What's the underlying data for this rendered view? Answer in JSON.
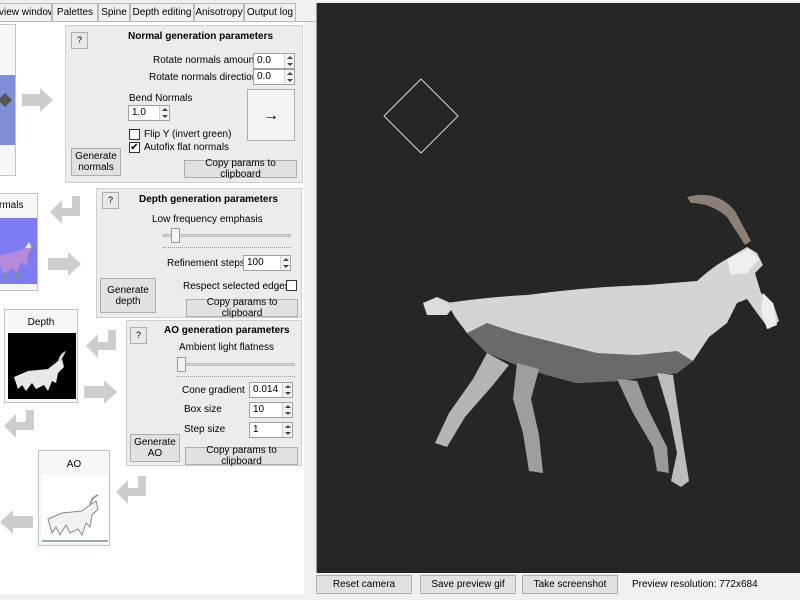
{
  "tabs": [
    {
      "label": "view window"
    },
    {
      "label": "Palettes"
    },
    {
      "label": "Spine"
    },
    {
      "label": "Depth editing"
    },
    {
      "label": "Anisotropy"
    },
    {
      "label": "Output log"
    }
  ],
  "normal_panel": {
    "help": "?",
    "title": "Normal generation parameters",
    "rotate_amount_label": "Rotate normals amount",
    "rotate_amount_value": "0.0",
    "rotate_direction_label": "Rotate normals direction",
    "rotate_direction_value": "0.0",
    "bend_label": "Bend Normals",
    "bend_value": "1.0",
    "flip_y_label": "Flip Y (invert green)",
    "flip_y_checked": false,
    "autofix_label": "Autofix flat normals",
    "autofix_checked": true,
    "direction_button": "→",
    "generate_label": "Generate normals",
    "copy_label": "Copy params to clipboard"
  },
  "depth_panel": {
    "help": "?",
    "title": "Depth generation parameters",
    "low_freq_label": "Low frequency emphasis",
    "low_freq_value": 0.0,
    "refinement_label": "Refinement steps:",
    "refinement_value": "100",
    "respect_edges_label": "Respect selected edges",
    "respect_edges_checked": false,
    "generate_label": "Generate depth",
    "copy_label": "Copy params to clipboard"
  },
  "ao_panel": {
    "help": "?",
    "title": "AO generation parameters",
    "flatness_label": "Ambient light flatness",
    "flatness_value": 0.0,
    "cone_label": "Cone gradient",
    "cone_value": "0.014",
    "box_label": "Box size",
    "box_value": "10",
    "step_label": "Step size",
    "step_value": "1",
    "generate_label": "Generate AO",
    "copy_label": "Copy params to clipboard"
  },
  "thumbnails": {
    "normals_label": "rmals",
    "depth_label": "Depth",
    "ao_label": "AO"
  },
  "bottom_bar": {
    "reset_camera": "Reset camera",
    "save_gif": "Save preview gif",
    "take_screenshot": "Take screenshot",
    "resolution": "Preview resolution: 772x684"
  },
  "colors": {
    "preview_background": "#262626",
    "normal_map": "#7d7df0",
    "panel": "#ececec"
  },
  "icons": [
    "arrow-right-icon",
    "arrow-down-left-icon",
    "light-direction-gizmo-icon",
    "goat-preview-icon"
  ]
}
